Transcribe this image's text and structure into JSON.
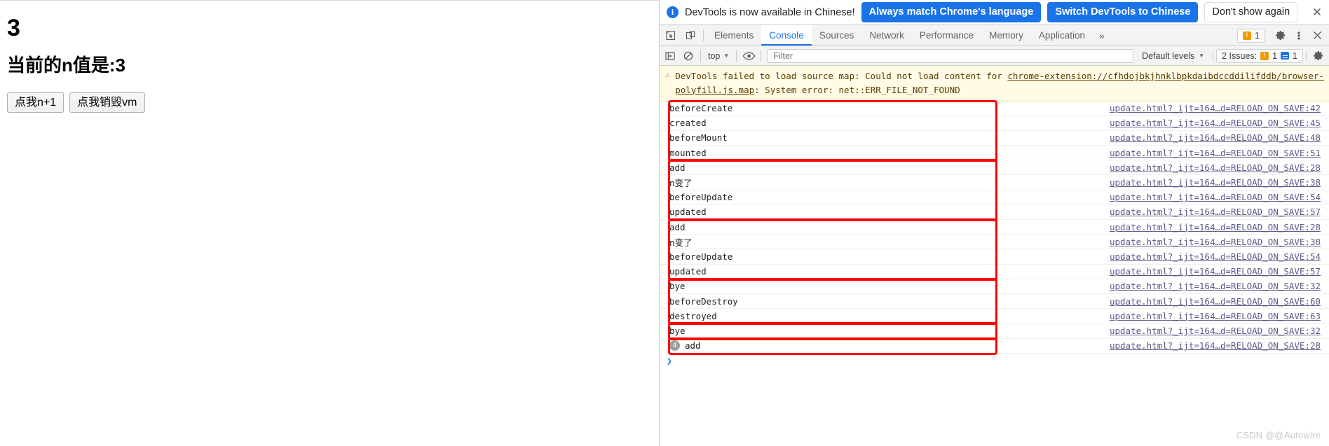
{
  "page": {
    "counter_value": "3",
    "n_label": "当前的n值是:3",
    "buttons": [
      {
        "label": "点我n+1",
        "name": "increment-button"
      },
      {
        "label": "点我销毁vm",
        "name": "destroy-vm-button"
      }
    ]
  },
  "devtools": {
    "infobar": {
      "icon": "info-icon",
      "message": "DevTools is now available in Chinese!",
      "primary_button_1": "Always match Chrome's language",
      "primary_button_2": "Switch DevTools to Chinese",
      "secondary_button": "Don't show again",
      "close": "✕"
    },
    "tabs": [
      {
        "label": "Elements",
        "active": false
      },
      {
        "label": "Console",
        "active": true
      },
      {
        "label": "Sources",
        "active": false
      },
      {
        "label": "Network",
        "active": false
      },
      {
        "label": "Performance",
        "active": false
      },
      {
        "label": "Memory",
        "active": false
      },
      {
        "label": "Application",
        "active": false
      }
    ],
    "tab_more": "»",
    "tabbar_issue_count": "1",
    "toolbar": {
      "context": "top",
      "filter_placeholder": "Filter",
      "levels": "Default levels",
      "issues_label": "2 Issues:",
      "issues_warning_count": "1",
      "issues_info_count": "1"
    },
    "warning": {
      "text_1": "DevTools failed to load source map: Could not load content for ",
      "link": "chrome-extension://cfhdojbkjhnklbpkdaibdccddilifddb/browser-polyfill.js.map",
      "text_2": ": System error: net::ERR_FILE_NOT_FOUND"
    },
    "log_entries": [
      {
        "text": "beforeCreate",
        "source": "update.html?_ijt=164…d=RELOAD_ON_SAVE:42",
        "repeat": null
      },
      {
        "text": "created",
        "source": "update.html?_ijt=164…d=RELOAD_ON_SAVE:45",
        "repeat": null
      },
      {
        "text": "beforeMount",
        "source": "update.html?_ijt=164…d=RELOAD_ON_SAVE:48",
        "repeat": null
      },
      {
        "text": "mounted",
        "source": "update.html?_ijt=164…d=RELOAD_ON_SAVE:51",
        "repeat": null
      },
      {
        "text": "add",
        "source": "update.html?_ijt=164…d=RELOAD_ON_SAVE:28",
        "repeat": null
      },
      {
        "text": "n变了",
        "source": "update.html?_ijt=164…d=RELOAD_ON_SAVE:38",
        "repeat": null
      },
      {
        "text": "beforeUpdate",
        "source": "update.html?_ijt=164…d=RELOAD_ON_SAVE:54",
        "repeat": null
      },
      {
        "text": "updated",
        "source": "update.html?_ijt=164…d=RELOAD_ON_SAVE:57",
        "repeat": null
      },
      {
        "text": "add",
        "source": "update.html?_ijt=164…d=RELOAD_ON_SAVE:28",
        "repeat": null
      },
      {
        "text": "n变了",
        "source": "update.html?_ijt=164…d=RELOAD_ON_SAVE:38",
        "repeat": null
      },
      {
        "text": "beforeUpdate",
        "source": "update.html?_ijt=164…d=RELOAD_ON_SAVE:54",
        "repeat": null
      },
      {
        "text": "updated",
        "source": "update.html?_ijt=164…d=RELOAD_ON_SAVE:57",
        "repeat": null
      },
      {
        "text": "bye",
        "source": "update.html?_ijt=164…d=RELOAD_ON_SAVE:32",
        "repeat": null
      },
      {
        "text": "beforeDestroy",
        "source": "update.html?_ijt=164…d=RELOAD_ON_SAVE:60",
        "repeat": null
      },
      {
        "text": "destroyed",
        "source": "update.html?_ijt=164…d=RELOAD_ON_SAVE:63",
        "repeat": null
      },
      {
        "text": "bye",
        "source": "update.html?_ijt=164…d=RELOAD_ON_SAVE:32",
        "repeat": null
      },
      {
        "text": "add",
        "source": "update.html?_ijt=164…d=RELOAD_ON_SAVE:28",
        "repeat": "4"
      }
    ],
    "annotations": [
      {
        "start": 0,
        "count": 4,
        "name": "annotation-box-lifecycle-create"
      },
      {
        "start": 4,
        "count": 4,
        "name": "annotation-box-update-1"
      },
      {
        "start": 8,
        "count": 4,
        "name": "annotation-box-update-2"
      },
      {
        "start": 12,
        "count": 3,
        "name": "annotation-box-destroy"
      },
      {
        "start": 15,
        "count": 1,
        "name": "annotation-box-bye"
      },
      {
        "start": 16,
        "count": 1,
        "name": "annotation-box-add-repeat"
      }
    ],
    "prompt_symbol": "❯",
    "watermark": "CSDN @@Autowire",
    "accent_color": "#1a73e8",
    "annotation_color": "#ff0000"
  }
}
